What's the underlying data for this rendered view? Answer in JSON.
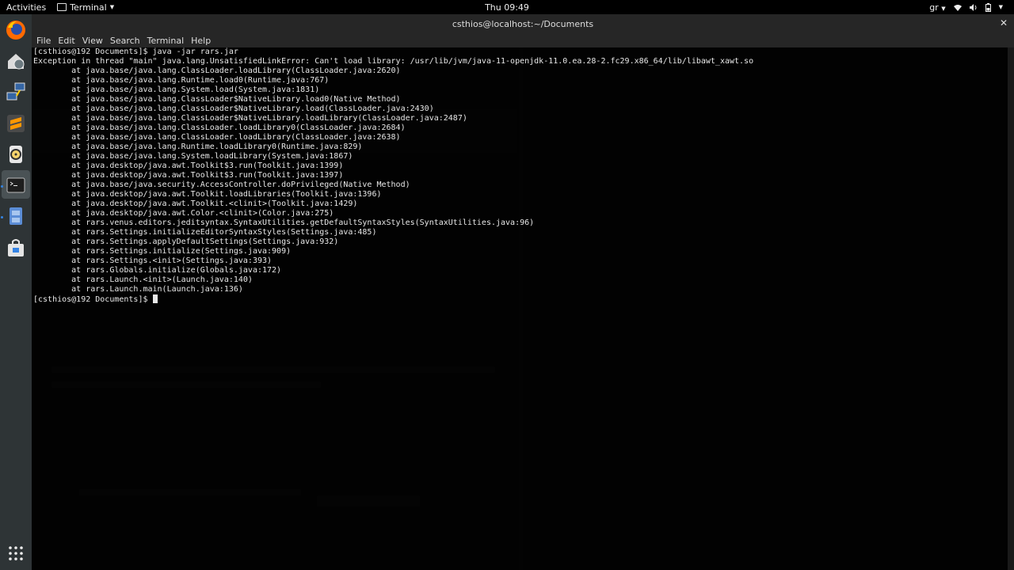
{
  "topbar": {
    "activities": "Activities",
    "app_name": "Terminal",
    "clock": "Thu 09:49",
    "keyboard_layout": "gr"
  },
  "dock": {
    "items": [
      {
        "name": "firefox-icon"
      },
      {
        "name": "network-home-icon"
      },
      {
        "name": "network-connection-icon"
      },
      {
        "name": "sublime-text-icon"
      },
      {
        "name": "rhythmbox-icon"
      },
      {
        "name": "terminal-icon"
      },
      {
        "name": "file-cabinet-icon"
      },
      {
        "name": "software-bag-icon"
      }
    ],
    "app_grid_icon": "app-grid-icon"
  },
  "window": {
    "title": "csthios@localhost:~/Documents",
    "menu": [
      "File",
      "Edit",
      "View",
      "Search",
      "Terminal",
      "Help"
    ]
  },
  "terminal": {
    "lines": [
      "[csthios@192 Documents]$ java -jar rars.jar",
      "Exception in thread \"main\" java.lang.UnsatisfiedLinkError: Can't load library: /usr/lib/jvm/java-11-openjdk-11.0.ea.28-2.fc29.x86_64/lib/libawt_xawt.so",
      "        at java.base/java.lang.ClassLoader.loadLibrary(ClassLoader.java:2620)",
      "        at java.base/java.lang.Runtime.load0(Runtime.java:767)",
      "        at java.base/java.lang.System.load(System.java:1831)",
      "        at java.base/java.lang.ClassLoader$NativeLibrary.load0(Native Method)",
      "        at java.base/java.lang.ClassLoader$NativeLibrary.load(ClassLoader.java:2430)",
      "        at java.base/java.lang.ClassLoader$NativeLibrary.loadLibrary(ClassLoader.java:2487)",
      "        at java.base/java.lang.ClassLoader.loadLibrary0(ClassLoader.java:2684)",
      "        at java.base/java.lang.ClassLoader.loadLibrary(ClassLoader.java:2638)",
      "        at java.base/java.lang.Runtime.loadLibrary0(Runtime.java:829)",
      "        at java.base/java.lang.System.loadLibrary(System.java:1867)",
      "        at java.desktop/java.awt.Toolkit$3.run(Toolkit.java:1399)",
      "        at java.desktop/java.awt.Toolkit$3.run(Toolkit.java:1397)",
      "        at java.base/java.security.AccessController.doPrivileged(Native Method)",
      "        at java.desktop/java.awt.Toolkit.loadLibraries(Toolkit.java:1396)",
      "        at java.desktop/java.awt.Toolkit.<clinit>(Toolkit.java:1429)",
      "        at java.desktop/java.awt.Color.<clinit>(Color.java:275)",
      "        at rars.venus.editors.jeditsyntax.SyntaxUtilities.getDefaultSyntaxStyles(SyntaxUtilities.java:96)",
      "        at rars.Settings.initializeEditorSyntaxStyles(Settings.java:485)",
      "        at rars.Settings.applyDefaultSettings(Settings.java:932)",
      "        at rars.Settings.initialize(Settings.java:909)",
      "        at rars.Settings.<init>(Settings.java:393)",
      "        at rars.Globals.initialize(Globals.java:172)",
      "        at rars.Launch.<init>(Launch.java:140)",
      "        at rars.Launch.main(Launch.java:136)"
    ],
    "prompt": "[csthios@192 Documents]$ "
  }
}
